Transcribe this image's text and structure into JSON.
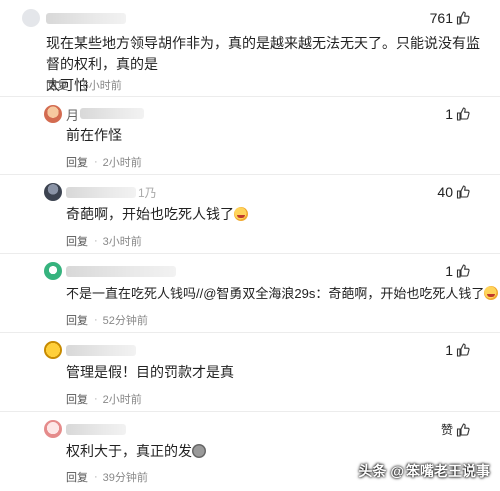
{
  "comments": [
    {
      "text_lines": [
        "现在某些地方领导胡作非为，真的是越来越无法无天了。只能说没有监督的权利，真的是",
        "太可怕"
      ],
      "likes": "761",
      "reply_label": "回复",
      "time": "6小时前"
    },
    {
      "username_fragment": "月",
      "text": "前在作怪",
      "likes": "1",
      "reply_label": "回复",
      "time": "2小时前"
    },
    {
      "username_fragment": "1乃",
      "text": "奇葩啊，开始也吃死人钱了",
      "likes": "40",
      "reply_label": "回复",
      "time": "3小时前"
    },
    {
      "text": "不是一直在吃死人钱吗//@智勇双全海浪29s：奇葩啊，开始也吃死人钱了",
      "likes": "1",
      "reply_label": "回复",
      "time": "52分钟前"
    },
    {
      "text": "管理是假！目的罚款才是真",
      "likes": "1",
      "reply_label": "回复",
      "time": "2小时前"
    },
    {
      "text": "权利大于，真正的发",
      "likes": "赞",
      "reply_label": "回复",
      "time": "39分钟前"
    }
  ],
  "watermark": {
    "brand": "头条",
    "at": "@",
    "author": "笨嘴老王说事"
  }
}
